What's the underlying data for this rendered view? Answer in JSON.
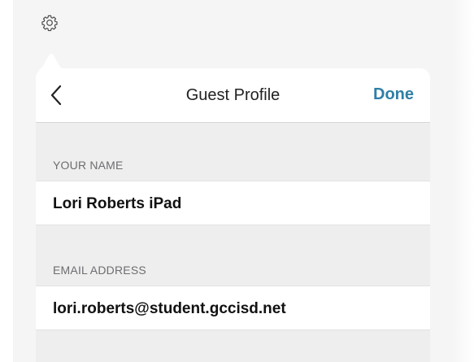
{
  "header": {
    "gear_icon": "gear-icon"
  },
  "popover": {
    "title": "Guest Profile",
    "back_icon": "chevron-left-icon",
    "done_label": "Done",
    "accent_color": "#2f7fa6"
  },
  "fields": [
    {
      "label": "YOUR NAME",
      "value": "Lori Roberts iPad"
    },
    {
      "label": "EMAIL ADDRESS",
      "value": "lori.roberts@student.gccisd.net"
    }
  ]
}
